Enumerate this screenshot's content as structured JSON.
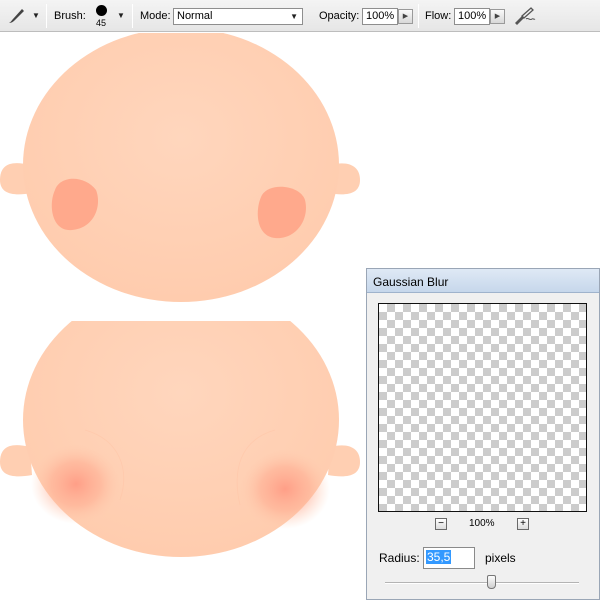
{
  "toolbar": {
    "tool_icon": "brush-tool-icon",
    "brush_label": "Brush:",
    "brush_size": "45",
    "mode_label": "Mode:",
    "mode_value": "Normal",
    "opacity_label": "Opacity:",
    "opacity_value": "100%",
    "flow_label": "Flow:",
    "flow_value": "100%",
    "airbrush_icon": "airbrush-icon"
  },
  "dialog": {
    "title": "Gaussian Blur",
    "zoom_value": "100%",
    "zoom_out_label": "−",
    "zoom_in_label": "+",
    "radius_label": "Radius:",
    "radius_value": "35,5",
    "radius_unit": "pixels",
    "radius_slider_fraction": 0.55
  },
  "colors": {
    "skin": "#ffd3b8",
    "cheek_solid": "#ffa98c",
    "cheek_blurred": "#ff9c85"
  }
}
